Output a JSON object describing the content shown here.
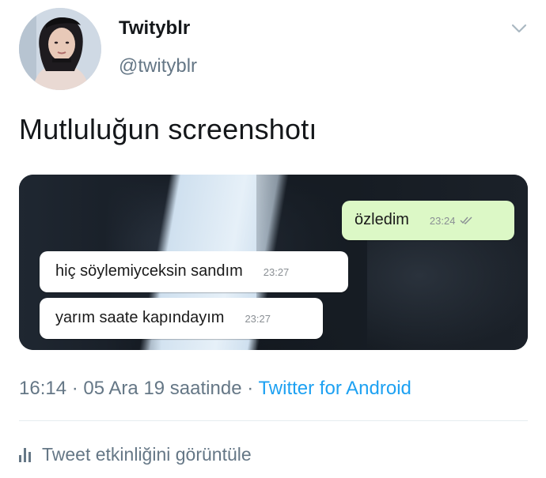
{
  "tweet": {
    "author": {
      "display_name": "Twityblr",
      "handle": "@twityblr"
    },
    "text": "Mutluluğun screenshotı",
    "timestamp": "16:14 · 05 Ara 19 saatinde",
    "separator": " · ",
    "source": "Twitter for Android",
    "activity_label": "Tweet etkinliğini görüntüle"
  },
  "media": {
    "messages": [
      {
        "direction": "outgoing",
        "text": "özledim",
        "time": "23:24",
        "status": "read-check-icon"
      },
      {
        "direction": "incoming",
        "text": "hiç söylemiyceksin sandım",
        "time": "23:27"
      },
      {
        "direction": "incoming",
        "text": "yarım saate kapındayım",
        "time": "23:27"
      }
    ]
  },
  "colors": {
    "link": "#1da1f2",
    "secondary_text": "#657786",
    "outgoing_bubble": "#dcf8c6"
  },
  "icons": {
    "menu": "chevron-down-icon",
    "activity": "bar-chart-icon"
  }
}
